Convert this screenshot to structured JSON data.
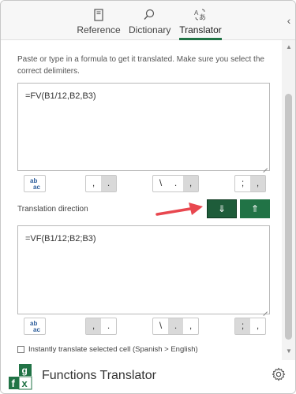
{
  "tabs": [
    {
      "label": "Reference",
      "icon": "reference-book-icon",
      "active": false
    },
    {
      "label": "Dictionary",
      "icon": "search-icon",
      "active": false
    },
    {
      "label": "Translator",
      "icon": "translate-icon",
      "active": true
    }
  ],
  "instructions": "Paste or type in a formula to get it translated. Make sure you select the correct delimiters.",
  "source_formula": "=FV(B1/12,B2,B3)",
  "translated_formula": "=VF(B1/12;B2;B3)",
  "translation_direction_label": "Translation direction",
  "direction_buttons": {
    "down": "⇓",
    "up": "⇑"
  },
  "top_delimiters": {
    "group1": [
      ",",
      "."
    ],
    "group2": [
      "\\",
      ".",
      ","
    ],
    "group3": [
      ";",
      ","
    ]
  },
  "bottom_delimiters": {
    "group1": [
      ",",
      "."
    ],
    "group2": [
      "\\",
      ".",
      ","
    ],
    "group3": [
      ";",
      ","
    ]
  },
  "checkbox_label": "Instantly translate selected cell (Spanish > English)",
  "footer_title": "Functions Translator",
  "logo_letters": {
    "g": "g",
    "f": "f",
    "x": "x"
  },
  "colors": {
    "accent": "#217346",
    "annotation_arrow": "#e8474f"
  }
}
